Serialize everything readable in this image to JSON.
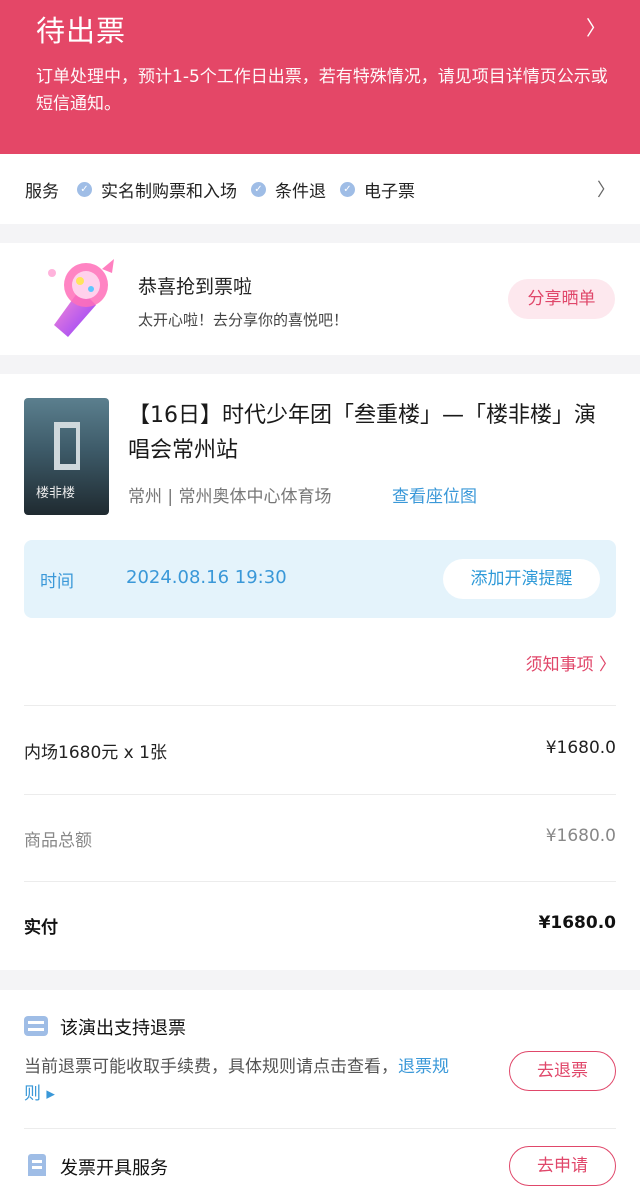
{
  "header": {
    "title": "待出票",
    "description": "订单处理中，预计1-5个工作日出票，若有特殊情况，请见项目详情页公示或短信通知。"
  },
  "service": {
    "label": "服务",
    "tags": [
      "实名制购票和入场",
      "条件退",
      "电子票"
    ]
  },
  "congrats": {
    "title": "恭喜抢到票啦",
    "subtitle": "太开心啦！去分享你的喜悦吧！",
    "share_button": "分享晒单"
  },
  "show": {
    "poster_text": "楼非楼",
    "title": "【16日】时代少年团「叁重楼」—「楼非楼」演唱会常州站",
    "venue": "常州 | 常州奥体中心体育场",
    "seat_map_link": "查看座位图",
    "time_label": "时间",
    "time_value": "2024.08.16 19:30",
    "remind_button": "添加开演提醒",
    "notice_link": "须知事项 〉"
  },
  "price": {
    "ticket_label": "内场1680元 x 1张",
    "ticket_value": "¥1680.0",
    "subtotal_label": "商品总额",
    "subtotal_value": "¥1680.0",
    "paid_label": "实付",
    "paid_value": "¥1680.0"
  },
  "refund": {
    "title": "该演出支持退票",
    "desc_prefix": "当前退票可能收取手续费，具体规则请点击查看，",
    "rule_link": "退票规则 ▸",
    "refund_button": "去退票",
    "invoice_title": "发票开具服务",
    "invoice_button": "去申请"
  },
  "colors": {
    "brand": "#e44767",
    "accent_blue": "#3a98d8"
  }
}
